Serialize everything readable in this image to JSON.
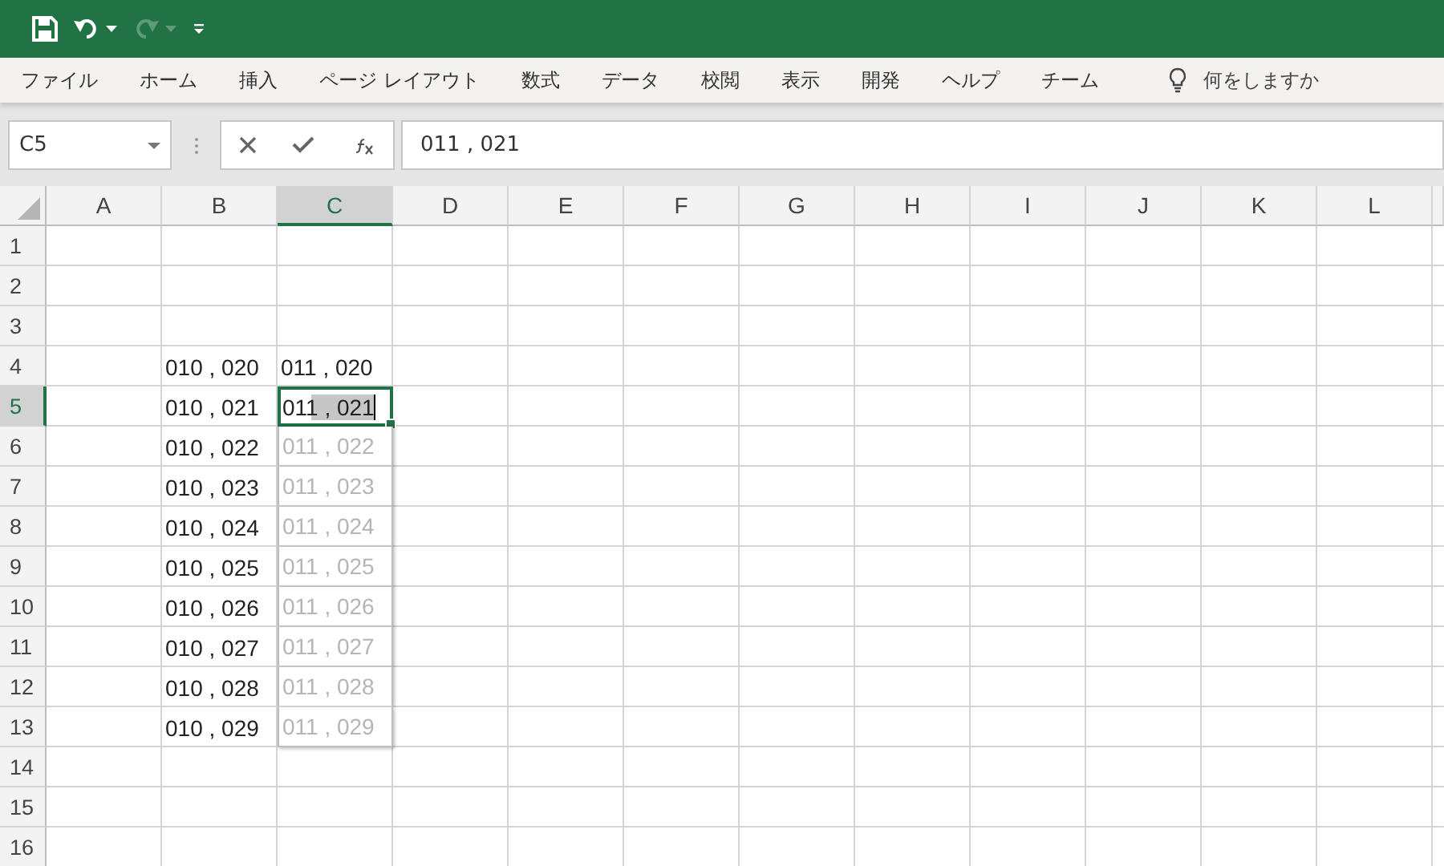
{
  "quick_access": [
    {
      "kind": "save",
      "disabled": false
    },
    {
      "kind": "undo",
      "disabled": false
    },
    {
      "kind": "redo",
      "disabled": true
    },
    {
      "kind": "customize",
      "disabled": false
    }
  ],
  "ribbon_tabs": [
    {
      "label": "ファイル",
      "selected": false
    },
    {
      "label": "ホーム",
      "selected": false
    },
    {
      "label": "挿入",
      "selected": false
    },
    {
      "label": "ページ レイアウト",
      "selected": false
    },
    {
      "label": "数式",
      "selected": false
    },
    {
      "label": "データ",
      "selected": false
    },
    {
      "label": "校閲",
      "selected": false
    },
    {
      "label": "表示",
      "selected": false
    },
    {
      "label": "開発",
      "selected": false
    },
    {
      "label": "ヘルプ",
      "selected": false
    },
    {
      "label": "チーム",
      "selected": false
    }
  ],
  "tell_me": {
    "placeholder": "何をしますか"
  },
  "name_box": {
    "value": "C5"
  },
  "formula_bar": {
    "value": "011 , 021"
  },
  "columns": [
    {
      "label": "A",
      "selected": false
    },
    {
      "label": "B",
      "selected": false
    },
    {
      "label": "C",
      "selected": true
    },
    {
      "label": "D",
      "selected": false
    },
    {
      "label": "E",
      "selected": false
    },
    {
      "label": "F",
      "selected": false
    },
    {
      "label": "G",
      "selected": false
    },
    {
      "label": "H",
      "selected": false
    },
    {
      "label": "I",
      "selected": false
    },
    {
      "label": "J",
      "selected": false
    },
    {
      "label": "K",
      "selected": false
    },
    {
      "label": "L",
      "selected": false
    }
  ],
  "rows": [
    {
      "number": "1",
      "selected": false
    },
    {
      "number": "2",
      "selected": false
    },
    {
      "number": "3",
      "selected": false
    },
    {
      "number": "4",
      "selected": false,
      "b": "010 , 020",
      "c": {
        "text": "011 , 020",
        "kind": "value"
      }
    },
    {
      "number": "5",
      "selected": true,
      "b": "010 , 021",
      "c": {
        "text": "011 , 021",
        "kind": "editing"
      }
    },
    {
      "number": "6",
      "selected": false,
      "b": "010 , 022",
      "c": {
        "text": "011 , 022",
        "kind": "preview"
      }
    },
    {
      "number": "7",
      "selected": false,
      "b": "010 , 023",
      "c": {
        "text": "011 , 023",
        "kind": "preview"
      }
    },
    {
      "number": "8",
      "selected": false,
      "b": "010 , 024",
      "c": {
        "text": "011 , 024",
        "kind": "preview"
      }
    },
    {
      "number": "9",
      "selected": false,
      "b": "010 , 025",
      "c": {
        "text": "011 , 025",
        "kind": "preview"
      }
    },
    {
      "number": "10",
      "selected": false,
      "b": "010 , 026",
      "c": {
        "text": "011 , 026",
        "kind": "preview"
      }
    },
    {
      "number": "11",
      "selected": false,
      "b": "010 , 027",
      "c": {
        "text": "011 , 027",
        "kind": "preview"
      }
    },
    {
      "number": "12",
      "selected": false,
      "b": "010 , 028",
      "c": {
        "text": "011 , 028",
        "kind": "preview"
      }
    },
    {
      "number": "13",
      "selected": false,
      "b": "010 , 029",
      "c": {
        "text": "011 , 029",
        "kind": "preview"
      }
    },
    {
      "number": "14",
      "selected": false
    },
    {
      "number": "15",
      "selected": false
    },
    {
      "number": "16",
      "selected": false
    }
  ]
}
